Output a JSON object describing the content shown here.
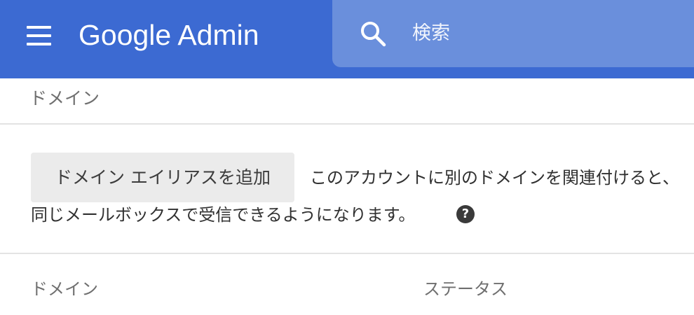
{
  "header": {
    "app_name": "Google Admin",
    "menu_icon": "hamburger-menu-icon",
    "search": {
      "icon": "search-icon",
      "placeholder": "検索"
    },
    "colors": {
      "bar": "#3c6ad2",
      "search_box": "#6a8fdc"
    }
  },
  "breadcrumb": {
    "current": "ドメイン"
  },
  "alias_section": {
    "add_button_label": "ドメイン エイリアスを追加",
    "description_line1": "このアカウントに別のドメインを関連付けると、",
    "description_line2": "同じメールボックスで受信できるようになります。",
    "help_icon": "help-circle-icon",
    "help_glyph": "?"
  },
  "table": {
    "columns": [
      "ドメイン",
      "ステータス"
    ]
  }
}
